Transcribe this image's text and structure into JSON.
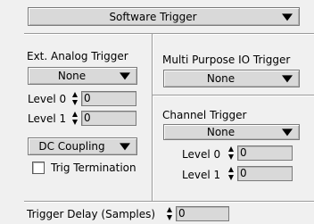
{
  "software_trigger": {
    "label": "Software Trigger"
  },
  "ext_analog": {
    "title": "Ext. Analog Trigger",
    "source_value": "None",
    "level0": {
      "label": "Level 0",
      "value": "0"
    },
    "level1": {
      "label": "Level 1",
      "value": "0"
    },
    "coupling_value": "DC Coupling",
    "trig_termination": {
      "label": "Trig Termination",
      "checked": false
    }
  },
  "multi_purpose": {
    "title": "Multi Purpose IO Trigger",
    "value": "None"
  },
  "channel_trigger": {
    "title": "Channel Trigger",
    "value": "None",
    "level0": {
      "label": "Level 0",
      "value": "0"
    },
    "level1": {
      "label": "Level 1",
      "value": "0"
    }
  },
  "trigger_delay": {
    "label": "Trigger Delay (Samples)",
    "value": "0"
  }
}
